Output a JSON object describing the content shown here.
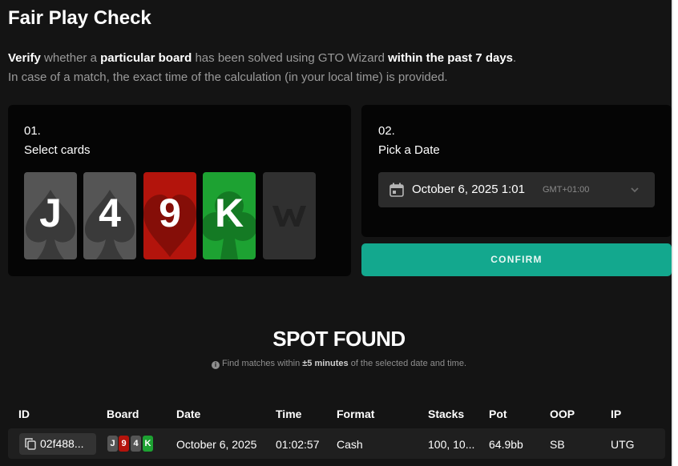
{
  "title": "Fair Play Check",
  "description": {
    "verify": "Verify",
    "t1": " whether a ",
    "particular_board": "particular board",
    "t2": " has been solved using GTO Wizard ",
    "past_days": "within the past 7 days",
    "t3": ".",
    "line2": "In case of a match, the exact time of the calculation (in your local time) is provided."
  },
  "cards_panel": {
    "step": "01.",
    "label": "Select cards",
    "cards": [
      {
        "rank": "J",
        "suit": "spade-icon",
        "color": "#555555"
      },
      {
        "rank": "4",
        "suit": "spade-icon",
        "color": "#555555"
      },
      {
        "rank": "9",
        "suit": "heart-icon",
        "color": "#b3140c"
      },
      {
        "rank": "K",
        "suit": "club-icon",
        "color": "#1da232"
      }
    ],
    "empty_slot_icon": "gto-wizard-logo"
  },
  "date_panel": {
    "step": "02.",
    "label": "Pick a Date",
    "date_value": "October 6, 2025 1:01",
    "timezone": "GMT+01:00",
    "calendar_icon": "calendar-icon",
    "chevron_icon": "chevron-down-icon"
  },
  "confirm_label": "CONFIRM",
  "result": {
    "heading": "SPOT FOUND",
    "note_pre": "Find matches within ",
    "note_bold": "±5 minutes",
    "note_post": " of the selected date and time."
  },
  "table": {
    "headers": {
      "id": "ID",
      "board": "Board",
      "date": "Date",
      "time": "Time",
      "format": "Format",
      "stacks": "Stacks",
      "pot": "Pot",
      "oop": "OOP",
      "ip": "IP"
    },
    "rows": [
      {
        "id": "02f488...",
        "board": [
          {
            "rank": "J",
            "color": "#555555"
          },
          {
            "rank": "9",
            "color": "#b3140c"
          },
          {
            "rank": "4",
            "color": "#555555"
          },
          {
            "rank": "K",
            "color": "#1da232"
          }
        ],
        "date": "October 6, 2025",
        "time": "01:02:57",
        "format": "Cash",
        "stacks": "100, 10...",
        "pot": "64.9bb",
        "oop": "SB",
        "ip": "UTG"
      }
    ]
  },
  "colors": {
    "background": "#141414",
    "panel": "#050505",
    "accent": "#13a88e"
  }
}
